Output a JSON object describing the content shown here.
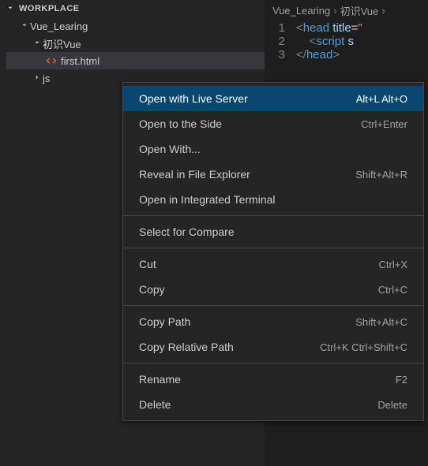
{
  "sidebar": {
    "section_title": "WORKPLACE",
    "items": [
      {
        "label": "Vue_Learing",
        "type": "folder",
        "expanded": true,
        "depth": 1
      },
      {
        "label": "初识Vue",
        "type": "folder",
        "expanded": true,
        "depth": 2
      },
      {
        "label": "first.html",
        "type": "file-html",
        "depth": 3,
        "selected": true
      },
      {
        "label": "js",
        "type": "folder",
        "expanded": false,
        "depth": 2
      }
    ]
  },
  "breadcrumb": {
    "parts": [
      "Vue_Learing",
      "初识Vue"
    ],
    "sep": "›"
  },
  "code": {
    "lines": [
      {
        "n": "1",
        "html": "<span class='tok-bracket'>&lt;</span><span class='tok-tag'>head</span> <span class='tok-attr'>title</span><span class='tok-op'>=</span><span class='tok-str'>\"</span>"
      },
      {
        "n": "2",
        "html": "    <span class='tok-bracket'>&lt;</span><span class='tok-tag'>script</span> <span class='tok-attr'>s</span>"
      },
      {
        "n": "3",
        "html": "<span class='tok-bracket'>&lt;/</span><span class='tok-tag'>head</span><span class='tok-bracket'>&gt;</span>"
      }
    ]
  },
  "context_menu": {
    "groups": [
      [
        {
          "label": "Open with Live Server",
          "shortcut": "Alt+L Alt+O",
          "highlighted": true
        },
        {
          "label": "Open to the Side",
          "shortcut": "Ctrl+Enter"
        },
        {
          "label": "Open With..."
        },
        {
          "label": "Reveal in File Explorer",
          "shortcut": "Shift+Alt+R"
        },
        {
          "label": "Open in Integrated Terminal"
        }
      ],
      [
        {
          "label": "Select for Compare"
        }
      ],
      [
        {
          "label": "Cut",
          "shortcut": "Ctrl+X"
        },
        {
          "label": "Copy",
          "shortcut": "Ctrl+C"
        }
      ],
      [
        {
          "label": "Copy Path",
          "shortcut": "Shift+Alt+C"
        },
        {
          "label": "Copy Relative Path",
          "shortcut": "Ctrl+K Ctrl+Shift+C"
        }
      ],
      [
        {
          "label": "Rename",
          "shortcut": "F2"
        },
        {
          "label": "Delete",
          "shortcut": "Delete"
        }
      ]
    ]
  }
}
